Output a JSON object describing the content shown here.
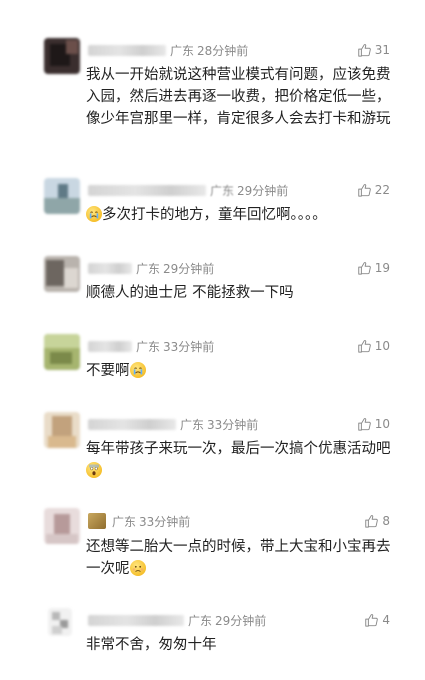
{
  "comments": [
    {
      "location": "广东",
      "time": "28分钟前",
      "likes": "31",
      "text": "我从一开始就说这种营业模式有问题，应该免费入园，然后进去再逐一收费，把价格定低一些，像少年宫那里一样，肯定很多人会去打卡和游玩"
    },
    {
      "location": "广东",
      "time": "29分钟前",
      "likes": "22",
      "emoji": "crying-face-emoji",
      "text": "多次打卡的地方，童年回忆啊。。。。"
    },
    {
      "location": "广东",
      "time": "29分钟前",
      "likes": "19",
      "text": "顺德人的迪士尼 不能拯救一下吗"
    },
    {
      "location": "广东",
      "time": "33分钟前",
      "likes": "10",
      "text": "不要啊",
      "emoji": "crying-face-emoji"
    },
    {
      "location": "广东",
      "time": "33分钟前",
      "likes": "10",
      "text": "每年带孩子来玩一次，最后一次搞个优惠活动吧",
      "emoji": "screaming-face-emoji"
    },
    {
      "location": "广东",
      "time": "33分钟前",
      "likes": "8",
      "text": "还想等二胎大一点的时候，带上大宝和小宝再去一次呢",
      "emoji": "sad-face-emoji"
    },
    {
      "location": "广东",
      "time": "29分钟前",
      "likes": "4",
      "text": "非常不舍，匆匆十年"
    }
  ],
  "colors": {
    "meta": "#8a8a8a",
    "text": "#222222",
    "background": "#ffffff"
  }
}
